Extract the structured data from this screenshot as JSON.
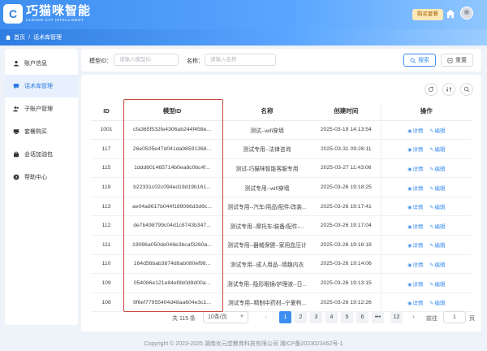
{
  "header": {
    "logo_glyph": "C",
    "logo_cn": "巧猫咪智能",
    "logo_en": "CLEVER CAT INTELLIGENT",
    "buy_label": "购买套餐"
  },
  "breadcrumb": {
    "home": "首页",
    "separator": "/",
    "current": "话术库管理"
  },
  "sidebar": {
    "items": [
      {
        "label": "账户信息",
        "icon": "user-icon"
      },
      {
        "label": "话术库管理",
        "icon": "chat-icon",
        "active": true
      },
      {
        "label": "子账户管理",
        "icon": "users-icon"
      },
      {
        "label": "套餐购买",
        "icon": "package-icon"
      },
      {
        "label": "会话加油包",
        "icon": "bag-icon"
      },
      {
        "label": "帮助中心",
        "icon": "help-icon"
      }
    ]
  },
  "search": {
    "model_id_label": "模型ID：",
    "model_id_placeholder": "请输入模型ID",
    "name_label": "名称：",
    "name_placeholder": "请输入名称",
    "search_label": "搜索",
    "reset_label": "重置"
  },
  "table": {
    "columns": [
      "ID",
      "模型ID",
      "名称",
      "创建时间",
      "操作"
    ],
    "detail_label": "详情",
    "edit_label": "编辑",
    "rows": [
      {
        "id": "1001",
        "model_id": "cfa365f532fe4306ab244f458e...",
        "name": "测试--wifi穿墙",
        "created": "2025-03-19 14:13:54"
      },
      {
        "id": "117",
        "model_id": "26e0505e47d041da98591368...",
        "name": "测试专用--法律咨询",
        "created": "2025-03-31 09:26:11"
      },
      {
        "id": "115",
        "model_id": "1ddd601465714b0ea8c0bc4f...",
        "name": "测试-巧猫咪智能客服专用",
        "created": "2025-03-27 11:43:06"
      },
      {
        "id": "119",
        "model_id": "b22331c02c094ed19d19b161...",
        "name": "测试专用--wifi穿墙",
        "created": "2025-03-26 19:18:25"
      },
      {
        "id": "113",
        "model_id": "ae04a8617b044f189086d3d9c...",
        "name": "测试专用--汽车/用品/配件/改装...",
        "created": "2025-03-26 19:17:41"
      },
      {
        "id": "112",
        "model_id": "de7b498799c04d1c8743b347...",
        "name": "测试专用--摩托车/装备/配件-...",
        "created": "2025-03-26 19:17:04"
      },
      {
        "id": "111",
        "model_id": "19086a050de048e3bcaf3260a...",
        "name": "测试专用--器械保健--家用血压计",
        "created": "2025-03-26 19:16:18"
      },
      {
        "id": "110",
        "model_id": "164d56bab3874d8ab080ef98...",
        "name": "测试专用--成人用品--情趣内衣",
        "created": "2025-03-26 19:14:06"
      },
      {
        "id": "109",
        "model_id": "054086e121e84ef8b0d9d00a...",
        "name": "测试专用--隐形眼镜/护理液--日...",
        "created": "2025-03-26 19:13:15"
      },
      {
        "id": "108",
        "model_id": "9f6ef77955404d48aa604e3c1...",
        "name": "测试专用--精制中药材--宁夏枸...",
        "created": "2025-03-26 19:12:26"
      }
    ]
  },
  "pagination": {
    "total": "共 115 条",
    "page_size": "10条/页",
    "pages": [
      "1",
      "2",
      "3",
      "4",
      "5",
      "6",
      "•••",
      "12"
    ],
    "current": "1",
    "goto_label": "前往",
    "goto_value": "1",
    "page_unit": "页"
  },
  "footer": {
    "copyright": "Copyright © 2023-2025 湖南优元堂教育科技有限公司 湘ICP备2023023462号-1"
  },
  "colors": {
    "primary": "#3d8ef0",
    "highlight_box": "#c9463d",
    "buy_bg": "#ffe9b8"
  }
}
